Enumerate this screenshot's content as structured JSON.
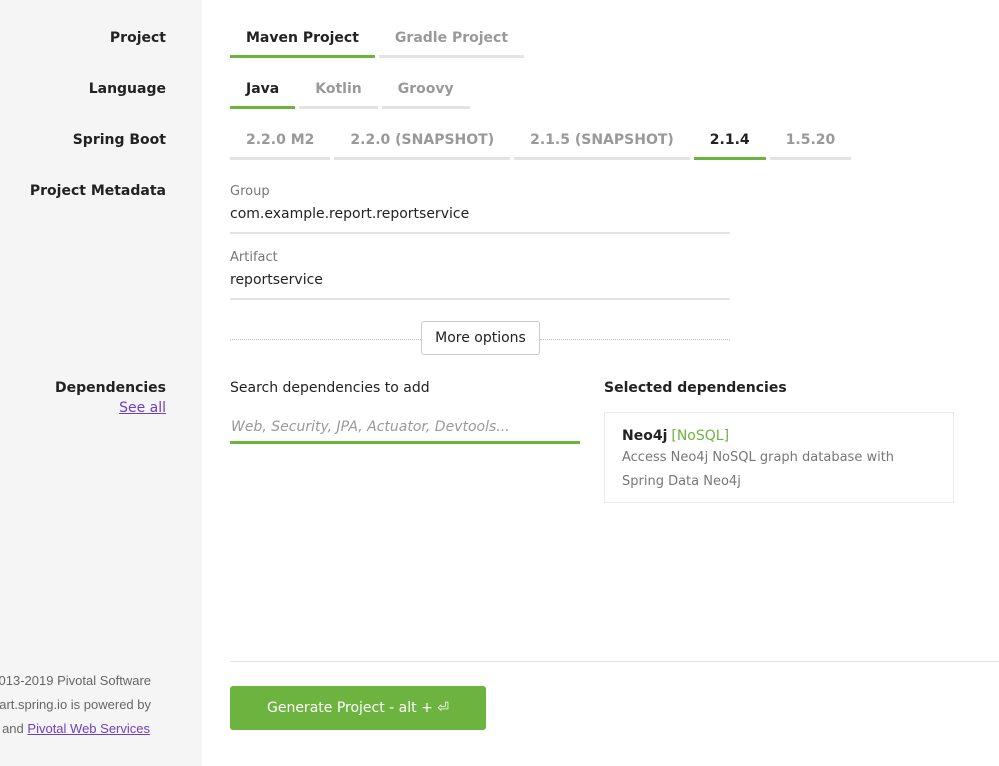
{
  "labels": {
    "project": "Project",
    "language": "Language",
    "spring_boot": "Spring Boot",
    "project_metadata": "Project Metadata",
    "dependencies": "Dependencies",
    "see_all": "See all"
  },
  "project": {
    "options": [
      "Maven Project",
      "Gradle Project"
    ],
    "selected": "Maven Project"
  },
  "language": {
    "options": [
      "Java",
      "Kotlin",
      "Groovy"
    ],
    "selected": "Java"
  },
  "spring_boot": {
    "options": [
      "2.2.0 M2",
      "2.2.0 (SNAPSHOT)",
      "2.1.5 (SNAPSHOT)",
      "2.1.4",
      "1.5.20"
    ],
    "selected": "2.1.4"
  },
  "metadata": {
    "group_label": "Group",
    "group_value": "com.example.report.reportservice",
    "artifact_label": "Artifact",
    "artifact_value": "reportservice",
    "more_options": "More options"
  },
  "dependencies": {
    "search_label": "Search dependencies to add",
    "search_placeholder": "Web, Security, JPA, Actuator, Devtools...",
    "selected_title": "Selected dependencies",
    "selected": [
      {
        "name": "Neo4j",
        "group": "[NoSQL]",
        "description_line1": "Access Neo4j NoSQL graph database with",
        "description_line2": "Spring Data Neo4j"
      }
    ]
  },
  "actions": {
    "generate": "Generate Project - alt + ⏎"
  },
  "footer": {
    "line1": "013-2019 Pivotal Software",
    "line2": "art.spring.io is powered by",
    "line3_prefix": "and",
    "line3_link": "Pivotal Web Services"
  },
  "colors": {
    "accent": "#6db33f",
    "link": "#6d3fc8",
    "sidebar_bg": "#f5f5f5"
  }
}
